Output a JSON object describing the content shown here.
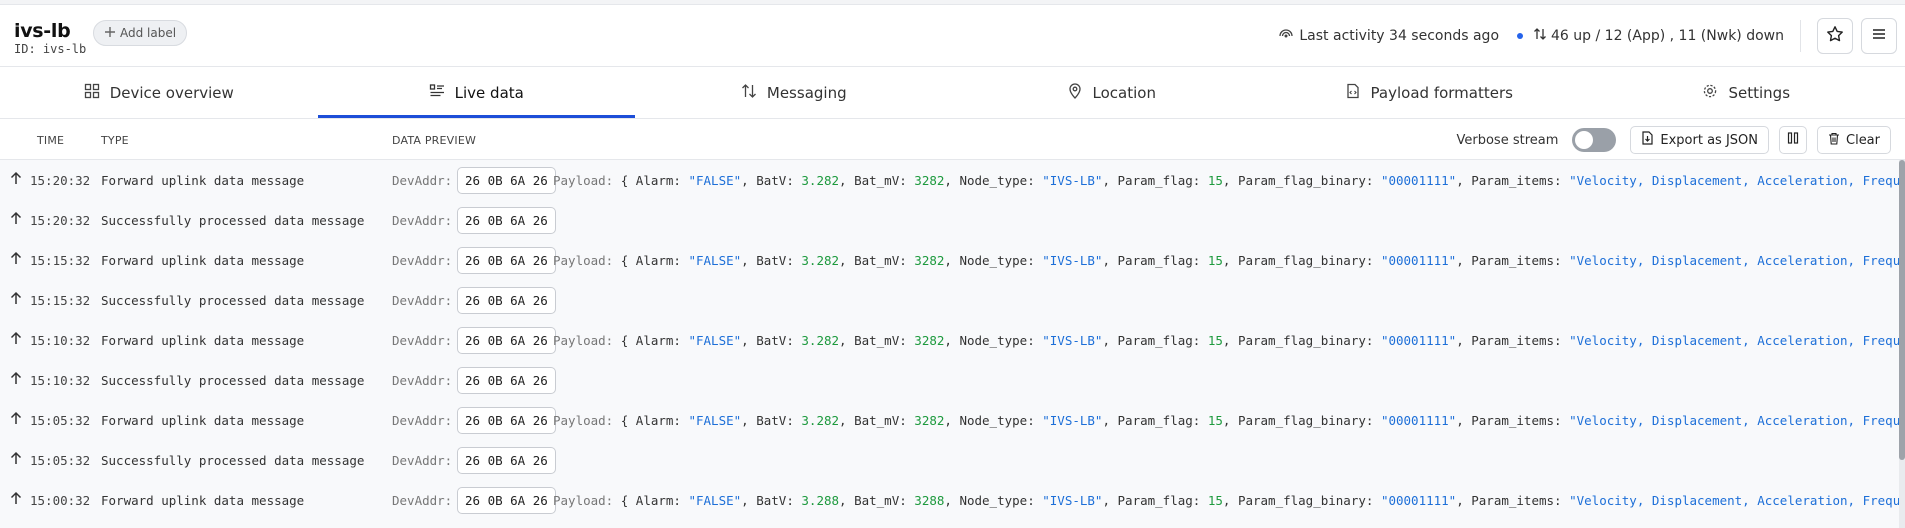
{
  "device": {
    "title": "ivs-lb",
    "id_text": "ID: ivs-lb",
    "add_label": "Add label",
    "activity": "Last activity 34 seconds ago",
    "traffic": "46 up / 12 (App) , 11 (Nwk) down"
  },
  "tabs": [
    {
      "label": "Device overview",
      "icon": "grid-icon"
    },
    {
      "label": "Live data",
      "icon": "list-icon",
      "active": true
    },
    {
      "label": "Messaging",
      "icon": "up-down-arrows-icon"
    },
    {
      "label": "Location",
      "icon": "map-pin-icon"
    },
    {
      "label": "Payload formatters",
      "icon": "document-code-icon"
    },
    {
      "label": "Settings",
      "icon": "gear-icon"
    }
  ],
  "columns": {
    "time": "TIME",
    "type": "TYPE",
    "preview": "DATA PREVIEW"
  },
  "controls": {
    "verbose": "Verbose stream",
    "export": "Export as JSON",
    "clear": "Clear"
  },
  "labels": {
    "devaddr": "DevAddr:",
    "payload": "Payload:"
  },
  "colors": {
    "accent": "#1d4ed8",
    "string": "#1d6fd8",
    "number": "#1e9a3e"
  },
  "events": [
    {
      "time": "15:20:32",
      "type": "Forward uplink data message",
      "devaddr": "26 0B 6A 26",
      "batv": "3.282",
      "batmv": "3282"
    },
    {
      "time": "15:20:32",
      "type": "Successfully processed data message",
      "devaddr": "26 0B 6A 26"
    },
    {
      "time": "15:15:32",
      "type": "Forward uplink data message",
      "devaddr": "26 0B 6A 26",
      "batv": "3.282",
      "batmv": "3282"
    },
    {
      "time": "15:15:32",
      "type": "Successfully processed data message",
      "devaddr": "26 0B 6A 26"
    },
    {
      "time": "15:10:32",
      "type": "Forward uplink data message",
      "devaddr": "26 0B 6A 26",
      "batv": "3.282",
      "batmv": "3282"
    },
    {
      "time": "15:10:32",
      "type": "Successfully processed data message",
      "devaddr": "26 0B 6A 26"
    },
    {
      "time": "15:05:32",
      "type": "Forward uplink data message",
      "devaddr": "26 0B 6A 26",
      "batv": "3.282",
      "batmv": "3282"
    },
    {
      "time": "15:05:32",
      "type": "Successfully processed data message",
      "devaddr": "26 0B 6A 26"
    },
    {
      "time": "15:00:32",
      "type": "Forward uplink data message",
      "devaddr": "26 0B 6A 26",
      "batv": "3.288",
      "batmv": "3288"
    }
  ],
  "payload_fields": {
    "alarm": "\"FALSE\"",
    "node_type": "\"IVS-LB\"",
    "param_flag": "15",
    "param_flag_binary": "\"00001111\"",
    "param_items": "\"Velocity, Displacement, Acceleration, Frequency\""
  }
}
